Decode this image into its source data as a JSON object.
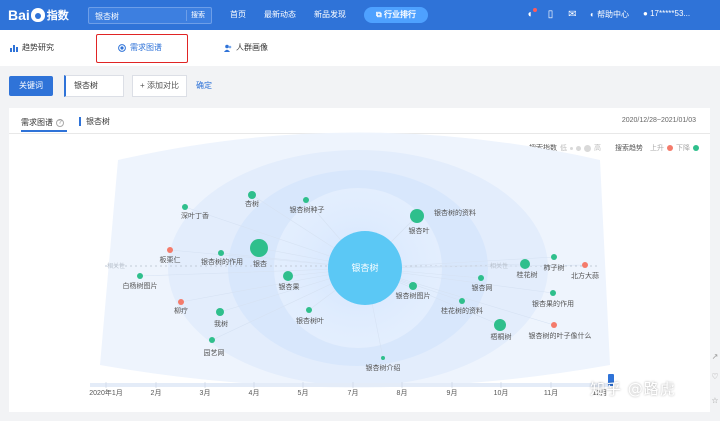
{
  "header": {
    "logo_text": "Bai",
    "logo_suffix": "指数",
    "search_value": "银杏树",
    "search_button": "搜索",
    "nav": [
      "首页",
      "最新动态",
      "新品发现"
    ],
    "nav_pill": "行业排行",
    "help": "帮助中心",
    "user": "17*****53..."
  },
  "subtabs": [
    "趋势研究",
    "需求图谱",
    "人群画像"
  ],
  "keyword_row": {
    "keyword_button": "关键词",
    "keyword_value": "银杏树",
    "add_compare": "+ 添加对比",
    "confirm": "确定"
  },
  "card": {
    "tab_label": "需求图谱",
    "keyword": "银杏树",
    "date_range": "2020/12/28~2021/01/03",
    "legend_index_label": "搜索指数",
    "legend_low": "低",
    "legend_high": "高",
    "legend_trend_label": "搜索趋势",
    "legend_up": "上升",
    "legend_down": "下降"
  },
  "graph": {
    "center": "银杏树",
    "axis_left_label": "相关性",
    "axis_right_label": "相关性",
    "colors": {
      "up": "#f47b6b",
      "down": "#2fbf8c",
      "center": "#5bc8f5"
    },
    "nodes": [
      {
        "label": "深叶丁香",
        "trend": "down",
        "size": 3
      },
      {
        "label": "杏树",
        "trend": "down",
        "size": 4
      },
      {
        "label": "银杏树种子",
        "trend": "down",
        "size": 3
      },
      {
        "label": "银杏树的资料",
        "trend": "down",
        "size": 3
      },
      {
        "label": "银杏叶",
        "trend": "down",
        "size": 7
      },
      {
        "label": "板栗仁",
        "trend": "up",
        "size": 3
      },
      {
        "label": "银杏树的作用",
        "trend": "down",
        "size": 3
      },
      {
        "label": "银杏",
        "trend": "down",
        "size": 9
      },
      {
        "label": "银杏果",
        "trend": "down",
        "size": 5
      },
      {
        "label": "白杨树图片",
        "trend": "down",
        "size": 3
      },
      {
        "label": "桂花树",
        "trend": "down",
        "size": 5
      },
      {
        "label": "柿子树",
        "trend": "down",
        "size": 3
      },
      {
        "label": "北方大蒜",
        "trend": "up",
        "size": 3
      },
      {
        "label": "银杏网",
        "trend": "down",
        "size": 3
      },
      {
        "label": "银杏树图片",
        "trend": "down",
        "size": 4
      },
      {
        "label": "柳疗",
        "trend": "up",
        "size": 3
      },
      {
        "label": "桂花树的资料",
        "trend": "down",
        "size": 3
      },
      {
        "label": "我树",
        "trend": "down",
        "size": 4
      },
      {
        "label": "银杏果的作用",
        "trend": "down",
        "size": 3
      },
      {
        "label": "银杏树叶",
        "trend": "down",
        "size": 3
      },
      {
        "label": "梧桐树",
        "trend": "down",
        "size": 6
      },
      {
        "label": "银杏树的叶子像什么",
        "trend": "up",
        "size": 3
      },
      {
        "label": "园艺网",
        "trend": "down",
        "size": 3
      },
      {
        "label": "银杏树介绍",
        "trend": "down",
        "size": 2
      }
    ],
    "months": [
      "2020年1月",
      "2月",
      "3月",
      "4月",
      "5月",
      "7月",
      "8月",
      "9月",
      "10月",
      "11月",
      "12月"
    ]
  },
  "watermark": "知乎 @路虎"
}
